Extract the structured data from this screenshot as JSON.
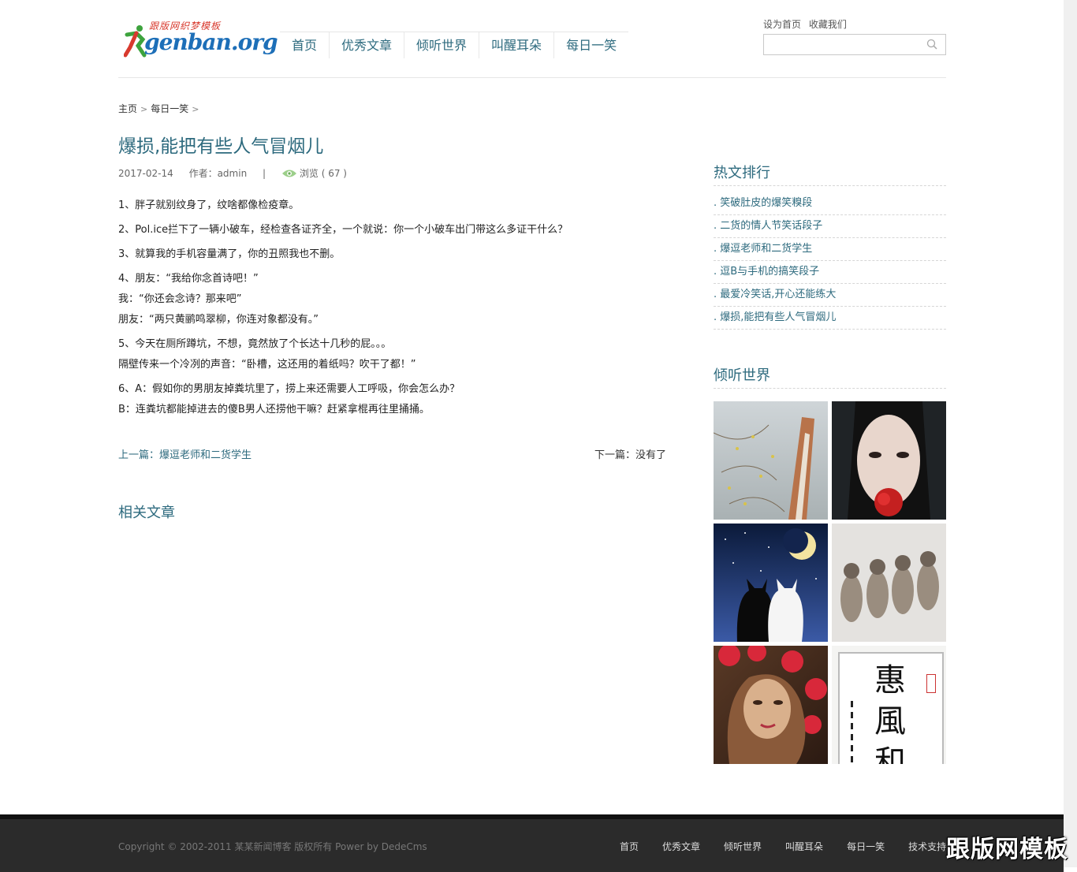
{
  "header": {
    "logo_cn": "跟版网织梦模板",
    "logo_en": "genban.org",
    "nav": [
      "首页",
      "优秀文章",
      "倾听世界",
      "叫醒耳朵",
      "每日一笑"
    ],
    "top_links": [
      "设为首页",
      "收藏我们"
    ],
    "search_placeholder": ""
  },
  "breadcrumb": {
    "home": "主页",
    "category": "每日一笑",
    "sep": ">"
  },
  "article": {
    "title": "爆损,能把有些人气冒烟儿",
    "date": "2017-02-14",
    "author": "作者：admin",
    "divider": "|",
    "views": "浏览 ( 67 )",
    "paragraphs": [
      [
        "1、胖子就别纹身了，纹啥都像检疫章。"
      ],
      [
        "2、Pol.ice拦下了一辆小破车，经检查各证齐全，一个就说：你一个小破车出门带这么多证干什么？"
      ],
      [
        "3、就算我的手机容量满了，你的丑照我也不删。"
      ],
      [
        "4、朋友：“我给你念首诗吧！”",
        "我：“你还会念诗？那来吧”",
        "朋友：“两只黄鹂鸣翠柳，你连对象都没有。”"
      ],
      [
        "5、今天在厕所蹲坑，不想，竟然放了个长达十几秒的屁。。。",
        "隔壁传来一个冷冽的声音：“卧槽，这还用的着纸吗？吹干了都！”"
      ],
      [
        "6、A：假如你的男朋友掉粪坑里了，捞上来还需要人工呼吸，你会怎么办？",
        "B：连粪坑都能掉进去的傻B男人还捞他干嘛？赶紧拿棍再往里捅捅。"
      ]
    ],
    "prev": "上一篇：爆逗老师和二货学生",
    "next": "下一篇：没有了",
    "related_title": "相关文章"
  },
  "sidebar": {
    "hot_title": "热文排行",
    "hot_items": [
      ". 笑破肚皮的爆笑糗段",
      ". 二货的情人节笑话段子",
      ". 爆逗老师和二货学生",
      ". 逗B与手机的搞笑段子",
      ". 最爱冷笑话,开心还能练大",
      ". 爆损,能把有些人气冒烟儿"
    ],
    "gallery_title": "倾听世界",
    "calligraphy": [
      "惠",
      "風",
      "和"
    ]
  },
  "footer": {
    "copyright": "Copyright © 2002-2011 某某新闻博客 版权所有 Power by DedeCms",
    "nav": [
      "首页",
      "优秀文章",
      "倾听世界",
      "叫醒耳朵",
      "每日一笑",
      "技术支持"
    ]
  },
  "watermark": "跟版网模板"
}
